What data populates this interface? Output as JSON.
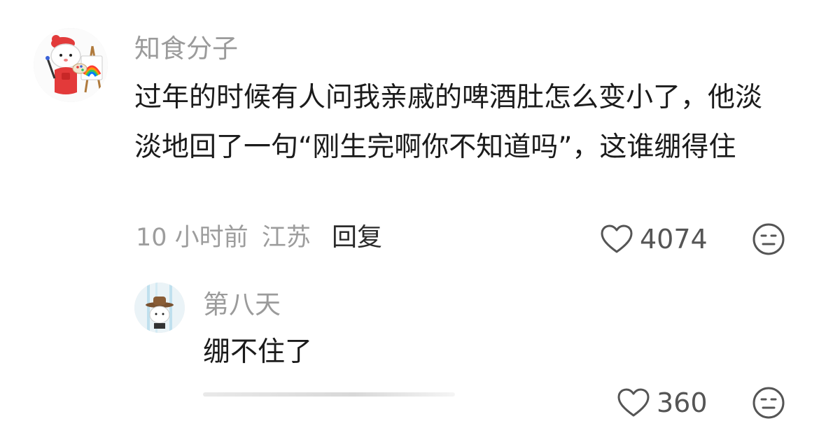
{
  "comments": [
    {
      "username": "知食分子",
      "content": "过年的时候有人问我亲戚的啤酒肚怎么变小了，他淡淡地回了一句“刚生完啊你不知道吗”，这谁绷得住",
      "time": "10 小时前",
      "location": "江苏",
      "reply_label": "回复",
      "likes": "4074",
      "avatar_icon": "chef-painter-avatar-icon",
      "action_icon": "meh-face-icon"
    },
    {
      "username": "第八天",
      "content": "绷不住了",
      "likes": "360",
      "avatar_icon": "cowboy-hat-character-avatar-icon",
      "action_icon": "meh-face-icon"
    }
  ],
  "colors": {
    "username": "#9b9b9b",
    "content": "#1b1b1b",
    "meta": "#9d9d9d",
    "icon_stroke": "#555555"
  }
}
